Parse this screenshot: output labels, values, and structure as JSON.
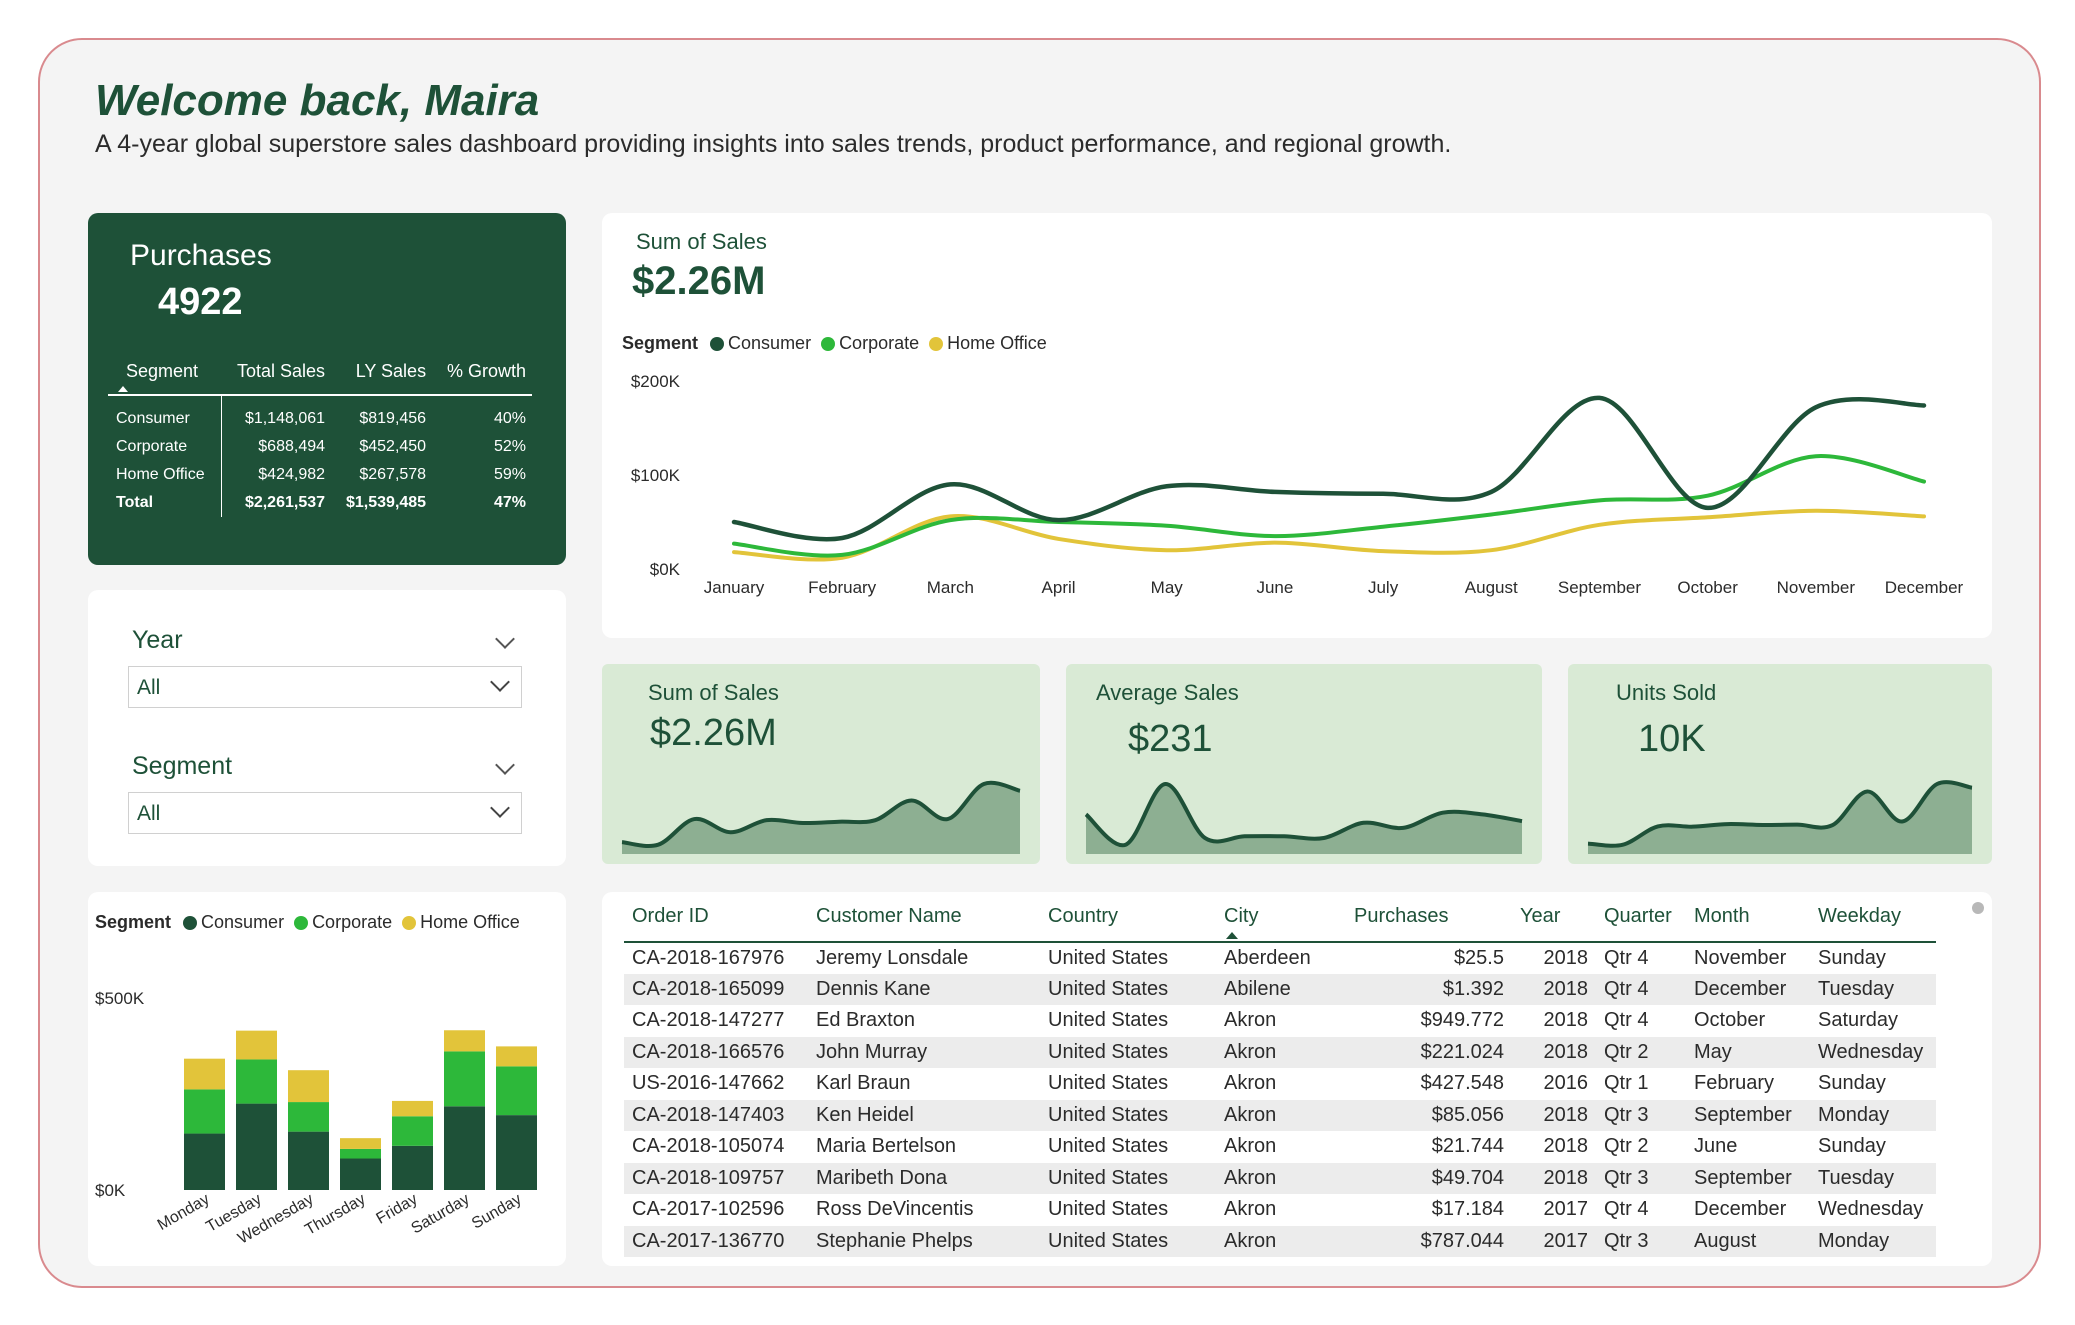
{
  "header": {
    "title": "Welcome back, Maira",
    "subtitle": "A 4-year global superstore sales dashboard providing insights into sales trends, product performance, and regional growth."
  },
  "purchases": {
    "label": "Purchases",
    "value": "4922",
    "table": {
      "columns": [
        "Segment",
        "Total Sales",
        "LY Sales",
        "% Growth"
      ],
      "rows": [
        [
          "Consumer",
          "$1,148,061",
          "$819,456",
          "40%"
        ],
        [
          "Corporate",
          "$688,494",
          "$452,450",
          "52%"
        ],
        [
          "Home Office",
          "$424,982",
          "$267,578",
          "59%"
        ]
      ],
      "total": [
        "Total",
        "$2,261,537",
        "$1,539,485",
        "47%"
      ]
    }
  },
  "filters": {
    "year": {
      "label": "Year",
      "value": "All"
    },
    "segment": {
      "label": "Segment",
      "value": "All"
    }
  },
  "colors": {
    "consumer": "#1e5138",
    "corporate": "#2db83a",
    "home_office": "#e2c43a",
    "kpi_fill": "#8daf92",
    "kpi_line": "#1e5138"
  },
  "legend": {
    "title": "Segment",
    "items": [
      "Consumer",
      "Corporate",
      "Home Office"
    ]
  },
  "sales_trend": {
    "title": "Sum of Sales",
    "value": "$2.26M"
  },
  "kpis": [
    {
      "title": "Sum of Sales",
      "value": "$2.26M"
    },
    {
      "title": "Average Sales",
      "value": "$231"
    },
    {
      "title": "Units Sold",
      "value": "10K"
    }
  ],
  "chart_data": [
    {
      "type": "line",
      "title": "Sum of Sales",
      "x": [
        "January",
        "February",
        "March",
        "April",
        "May",
        "June",
        "July",
        "August",
        "September",
        "October",
        "November",
        "December"
      ],
      "yticks": [
        "$200K",
        "$100K",
        "$0K"
      ],
      "ylim": [
        0,
        200000
      ],
      "legend": "top-left",
      "series": [
        {
          "name": "Consumer",
          "values": [
            50000,
            33000,
            90000,
            52000,
            88000,
            82000,
            80000,
            82000,
            182000,
            65000,
            172000,
            174000
          ]
        },
        {
          "name": "Corporate",
          "values": [
            27000,
            15000,
            52000,
            50000,
            46000,
            35000,
            45000,
            58000,
            73000,
            78000,
            120000,
            93000
          ]
        },
        {
          "name": "Home Office",
          "values": [
            18000,
            12000,
            56000,
            32000,
            20000,
            28000,
            19000,
            20000,
            47000,
            55000,
            62000,
            56000
          ]
        }
      ]
    },
    {
      "type": "area",
      "title": "Sum of Sales",
      "x": [
        "January",
        "February",
        "March",
        "April",
        "May",
        "June",
        "July",
        "August",
        "September",
        "October",
        "November",
        "December"
      ],
      "values": [
        95000,
        83000,
        200000,
        140000,
        195000,
        182000,
        188000,
        195000,
        285000,
        200000,
        360000,
        329000
      ]
    },
    {
      "type": "area",
      "title": "Average Sales",
      "x": [
        "January",
        "February",
        "March",
        "April",
        "May",
        "June",
        "July",
        "August",
        "September",
        "October",
        "November",
        "December"
      ],
      "values": [
        226,
        208,
        244,
        212,
        213,
        213,
        212,
        221,
        218,
        227,
        226,
        222
      ]
    },
    {
      "type": "area",
      "title": "Units Sold",
      "x": [
        "January",
        "February",
        "March",
        "April",
        "May",
        "June",
        "July",
        "August",
        "September",
        "October",
        "November",
        "December"
      ],
      "values": [
        360,
        340,
        660,
        655,
        700,
        685,
        690,
        680,
        1270,
        745,
        1400,
        1335
      ]
    },
    {
      "type": "bar",
      "stacked": true,
      "title": "",
      "categories": [
        "Monday",
        "Tuesday",
        "Wednesday",
        "Thursday",
        "Friday",
        "Saturday",
        "Sunday"
      ],
      "yticks": [
        "$500K",
        "$0K"
      ],
      "ylim": [
        0,
        500000
      ],
      "legend": "top-left",
      "series": [
        {
          "name": "Consumer",
          "values": [
            147000,
            225000,
            152000,
            82000,
            115000,
            218000,
            195000
          ]
        },
        {
          "name": "Corporate",
          "values": [
            115000,
            115000,
            77000,
            25000,
            77000,
            143000,
            127000
          ]
        },
        {
          "name": "Home Office",
          "values": [
            80000,
            75000,
            83000,
            28000,
            40000,
            55000,
            52000
          ]
        }
      ]
    }
  ],
  "orders": {
    "columns": [
      "Order ID",
      "Customer Name",
      "Country",
      "City",
      "Purchases",
      "Year",
      "Quarter",
      "Month",
      "Weekday"
    ],
    "rows": [
      [
        "CA-2018-167976",
        "Jeremy Lonsdale",
        "United States",
        "Aberdeen",
        "$25.5",
        "2018",
        "Qtr 4",
        "November",
        "Sunday"
      ],
      [
        "CA-2018-165099",
        "Dennis Kane",
        "United States",
        "Abilene",
        "$1.392",
        "2018",
        "Qtr 4",
        "December",
        "Tuesday"
      ],
      [
        "CA-2018-147277",
        "Ed Braxton",
        "United States",
        "Akron",
        "$949.772",
        "2018",
        "Qtr 4",
        "October",
        "Saturday"
      ],
      [
        "CA-2018-166576",
        "John Murray",
        "United States",
        "Akron",
        "$221.024",
        "2018",
        "Qtr 2",
        "May",
        "Wednesday"
      ],
      [
        "US-2016-147662",
        "Karl Braun",
        "United States",
        "Akron",
        "$427.548",
        "2016",
        "Qtr 1",
        "February",
        "Sunday"
      ],
      [
        "CA-2018-147403",
        "Ken Heidel",
        "United States",
        "Akron",
        "$85.056",
        "2018",
        "Qtr 3",
        "September",
        "Monday"
      ],
      [
        "CA-2018-105074",
        "Maria Bertelson",
        "United States",
        "Akron",
        "$21.744",
        "2018",
        "Qtr 2",
        "June",
        "Sunday"
      ],
      [
        "CA-2018-109757",
        "Maribeth Dona",
        "United States",
        "Akron",
        "$49.704",
        "2018",
        "Qtr 3",
        "September",
        "Tuesday"
      ],
      [
        "CA-2017-102596",
        "Ross DeVincentis",
        "United States",
        "Akron",
        "$17.184",
        "2017",
        "Qtr 4",
        "December",
        "Wednesday"
      ],
      [
        "CA-2017-136770",
        "Stephanie Phelps",
        "United States",
        "Akron",
        "$787.044",
        "2017",
        "Qtr 3",
        "August",
        "Monday"
      ]
    ]
  }
}
